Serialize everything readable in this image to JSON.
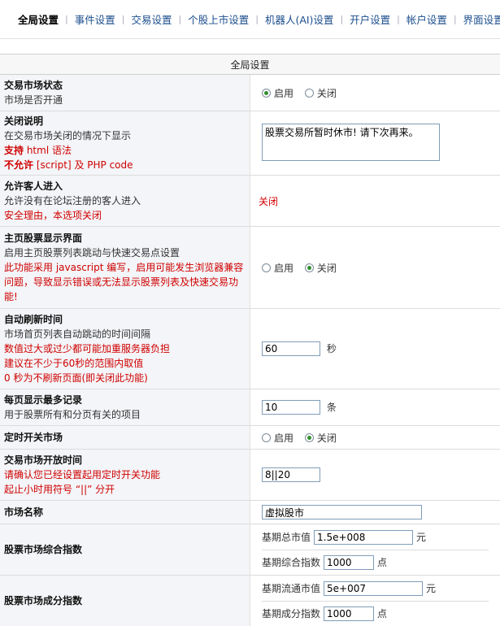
{
  "tabs": [
    {
      "label": "全局设置",
      "active": true
    },
    {
      "label": "事件设置"
    },
    {
      "label": "交易设置"
    },
    {
      "label": "个股上市设置"
    },
    {
      "label": "机器人(AI)设置"
    },
    {
      "label": "开户设置"
    },
    {
      "label": "帐户设置"
    },
    {
      "label": "界面设置"
    }
  ],
  "tab_sep": "|",
  "section_title": "全局设置",
  "radio_on": "启用",
  "radio_off": "关闭",
  "rows": {
    "market_status": {
      "title": "交易市场状态",
      "desc": "市场是否开通",
      "value": "on"
    },
    "close_note": {
      "title": "关闭说明",
      "desc": "在交易市场关闭的情况下显示",
      "w1_bold": "支持",
      "w1_text": " html 语法",
      "w2_bold": "不允许",
      "w2_text": " [script] 及 PHP code",
      "value": "股票交易所暂时休市! 请下次再来。"
    },
    "guest": {
      "title": "允许客人进入",
      "desc": "允许没有在论坛注册的客人进入",
      "warn": "安全理由，本选项关闭",
      "value_text": "关闭"
    },
    "home_ui": {
      "title": "主页股票显示界面",
      "desc": "启用主页股票列表跳动与快速交易点设置",
      "warn": "此功能采用 javascript 编写，启用可能发生浏览器兼容问题，导致显示错误或无法显示股票列表及快速交易功能!",
      "value": "off"
    },
    "refresh": {
      "title": "自动刷新时间",
      "desc": "市场首页列表自动跳动的时间间隔",
      "w1": "数值过大或过少都可能加重服务器负担",
      "w2": "建议在不少于60秒的范围内取值",
      "w3": "0 秒为不刷新页面(即关闭此功能)",
      "value": "60",
      "unit": "秒"
    },
    "per_page": {
      "title": "每页显示最多记录",
      "desc": "用于股票所有和分页有关的项目",
      "value": "10",
      "unit": "条"
    },
    "timer": {
      "title": "定时开关市场",
      "value": "off"
    },
    "open_time": {
      "title": "交易市场开放时间",
      "w1": "请确认您已经设置起用定时开关功能",
      "w2": "起止小时用符号 “||” 分开",
      "value": "8||20"
    },
    "market_name": {
      "title": "市场名称",
      "value": "虚拟股市"
    },
    "composite": {
      "title": "股票市场综合指数",
      "f1_label": "基期总市值",
      "f1_value": "1.5e+008",
      "f1_unit": "元",
      "f2_label": "基期综合指数",
      "f2_value": "1000",
      "f2_unit": "点"
    },
    "component": {
      "title": "股票市场成分指数",
      "f1_label": "基期流通市值",
      "f1_value": "5e+007",
      "f1_unit": "元",
      "f2_label": "基期成分指数",
      "f2_value": "1000",
      "f2_unit": "点"
    }
  }
}
